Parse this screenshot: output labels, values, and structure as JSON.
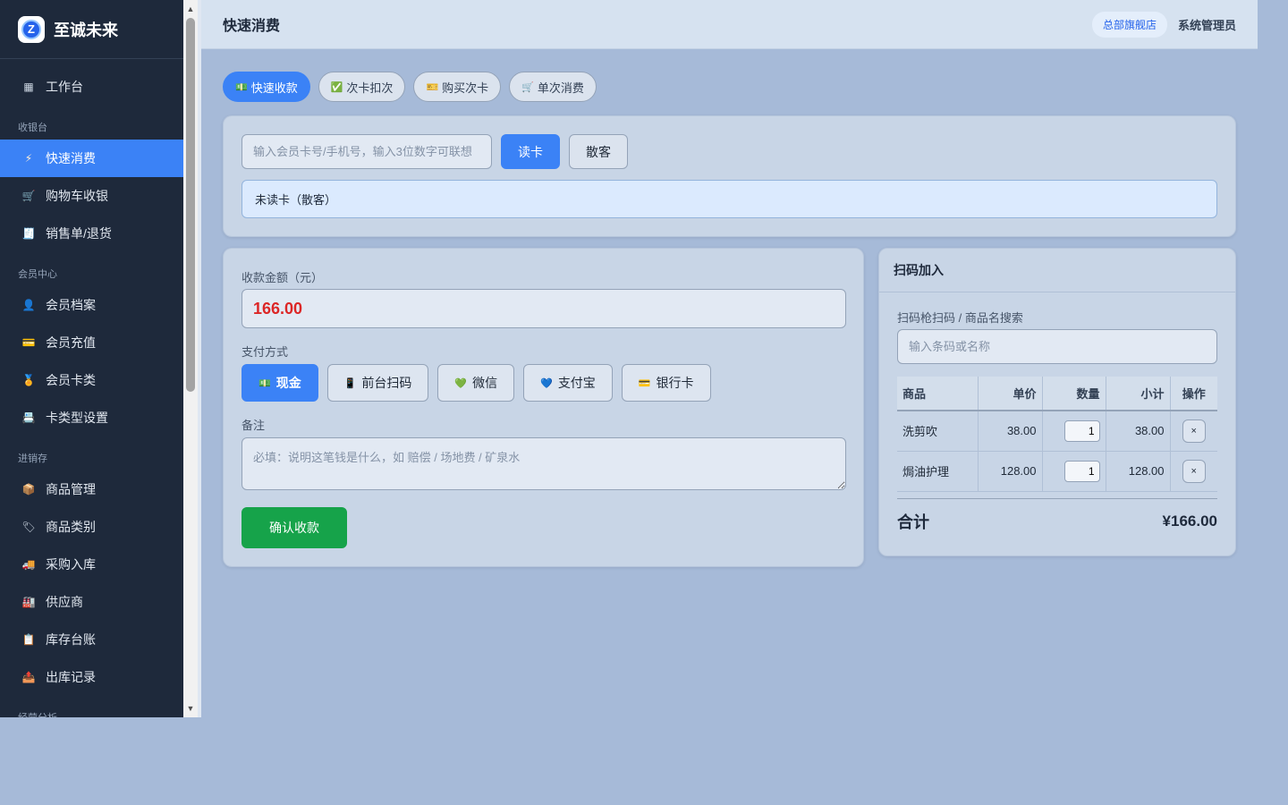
{
  "brand": {
    "name": "至诚未来",
    "logo_letter": "Z"
  },
  "sidebar": {
    "workbench": {
      "icon": "grid-icon",
      "glyph": "▦",
      "label": "工作台"
    },
    "groups": [
      {
        "title": "收银台",
        "items": [
          {
            "icon": "lightning-icon",
            "glyph": "⚡",
            "label": "快速消费",
            "active": true
          },
          {
            "icon": "cart-register-icon",
            "glyph": "🛒",
            "label": "购物车收银"
          },
          {
            "icon": "receipt-icon",
            "glyph": "🧾",
            "label": "销售单/退货"
          }
        ]
      },
      {
        "title": "会员中心",
        "items": [
          {
            "icon": "user-icon",
            "glyph": "👤",
            "label": "会员档案"
          },
          {
            "icon": "credit-card-icon",
            "glyph": "💳",
            "label": "会员充值"
          },
          {
            "icon": "medal-icon",
            "glyph": "🏅",
            "label": "会员卡类"
          },
          {
            "icon": "card-settings-icon",
            "glyph": "📇",
            "label": "卡类型设置"
          }
        ]
      },
      {
        "title": "进销存",
        "items": [
          {
            "icon": "package-icon",
            "glyph": "📦",
            "label": "商品管理"
          },
          {
            "icon": "tag-icon",
            "glyph": "🏷",
            "label": "商品类别"
          },
          {
            "icon": "truck-icon",
            "glyph": "🚚",
            "label": "采购入库"
          },
          {
            "icon": "factory-icon",
            "glyph": "🏭",
            "label": "供应商"
          },
          {
            "icon": "ledger-icon",
            "glyph": "📋",
            "label": "库存台账"
          },
          {
            "icon": "outbox-icon",
            "glyph": "📤",
            "label": "出库记录"
          }
        ]
      },
      {
        "title": "经营分析",
        "items": []
      }
    ]
  },
  "header": {
    "title": "快速消费",
    "store": "总部旗舰店",
    "user": "系统管理员"
  },
  "tabs": [
    {
      "icon": "cash-icon",
      "glyph": "💵",
      "label": "快速收款",
      "active": true
    },
    {
      "icon": "checkbox-icon",
      "glyph": "✅",
      "label": "次卡扣次"
    },
    {
      "icon": "ticket-icon",
      "glyph": "🎫",
      "label": "购买次卡"
    },
    {
      "icon": "cart-icon",
      "glyph": "🛒",
      "label": "单次消费"
    }
  ],
  "member": {
    "placeholder": "输入会员卡号/手机号，输入3位数字可联想",
    "read_card_label": "读卡",
    "walkin_label": "散客",
    "status": "未读卡（散客）"
  },
  "payment": {
    "amount_label": "收款金额（元）",
    "amount": "166.00",
    "method_label": "支付方式",
    "methods": [
      {
        "icon": "cash-icon",
        "glyph": "💵",
        "label": "现金",
        "active": true
      },
      {
        "icon": "phone-scan-icon",
        "glyph": "📱",
        "label": "前台扫码"
      },
      {
        "icon": "wechat-heart-icon",
        "glyph": "💚",
        "label": "微信"
      },
      {
        "icon": "alipay-heart-icon",
        "glyph": "💙",
        "label": "支付宝"
      },
      {
        "icon": "bank-card-icon",
        "glyph": "💳",
        "label": "银行卡"
      }
    ],
    "remark_label": "备注",
    "remark_placeholder": "必填：说明这笔钱是什么，如 赔偿 / 场地费 / 矿泉水",
    "confirm_label": "确认收款"
  },
  "scan": {
    "title": "扫码加入",
    "search_label": "扫码枪扫码 / 商品名搜索",
    "search_placeholder": "输入条码或名称",
    "columns": [
      "商品",
      "单价",
      "数量",
      "小计",
      "操作"
    ],
    "rows": [
      {
        "name": "洗剪吹",
        "price": "38.00",
        "qty": "1",
        "subtotal": "38.00",
        "action": "×"
      },
      {
        "name": "焗油护理",
        "price": "128.00",
        "qty": "1",
        "subtotal": "128.00",
        "action": "×"
      }
    ],
    "total_label": "合计",
    "total_value": "¥166.00"
  },
  "colors": {
    "sidebar_bg": "#1e293b",
    "accent": "#3b82f6",
    "confirm": "#16a34a",
    "amount": "#dc2626",
    "page_bg": "#a6bad8"
  }
}
